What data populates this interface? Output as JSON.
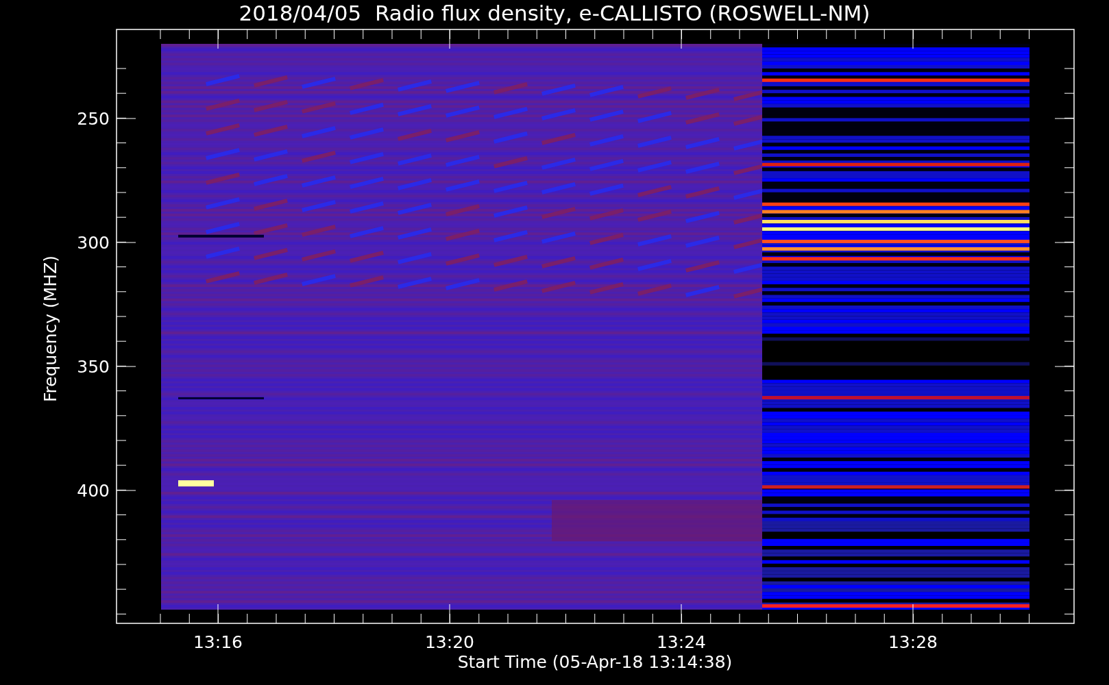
{
  "title": "2018/04/05  Radio flux density, e-CALLISTO (ROSWELL-NM)",
  "y_axis": {
    "label": "Frequency (MHZ)",
    "ticks": [
      "250",
      "300",
      "350",
      "400"
    ]
  },
  "x_axis": {
    "label": "Start Time (05-Apr-18 13:14:38)",
    "ticks": [
      "13:16",
      "13:20",
      "13:24",
      "13:28"
    ]
  }
}
